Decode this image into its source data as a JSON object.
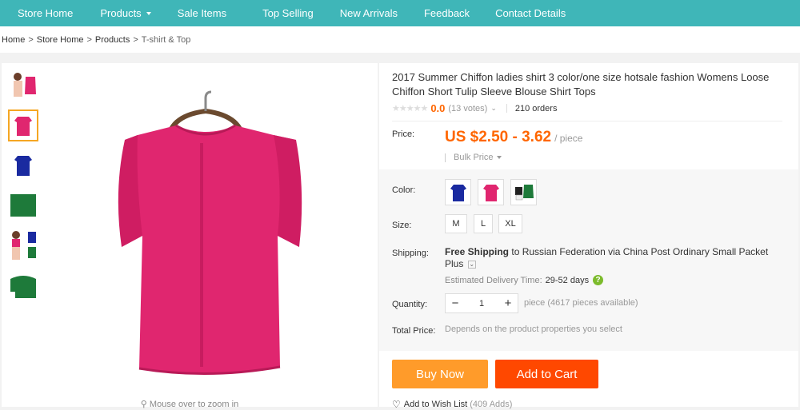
{
  "nav": {
    "items": [
      "Store Home",
      "Products",
      "Sale Items",
      "Top Selling",
      "New Arrivals",
      "Feedback",
      "Contact Details"
    ]
  },
  "breadcrumb": {
    "items": [
      "Home",
      "Store Home",
      "Products",
      "T-shirt & Top"
    ],
    "separator": ">"
  },
  "gallery": {
    "zoom_hint": "Mouse over to zoom in"
  },
  "product": {
    "title": "2017 Summer Chiffon ladies shirt 3 color/one size hotsale fashion Womens Loose Chiffon Short Tulip Sleeve Blouse Shirt Tops",
    "rating": {
      "score": "0.0",
      "votes": "(13 votes)",
      "orders": "210 orders"
    },
    "price": {
      "label": "Price:",
      "value": "US $2.50 - 3.62",
      "unit": "/ piece",
      "bulk_label": "Bulk Price"
    },
    "color": {
      "label": "Color:",
      "options": [
        "blue",
        "rose",
        "green"
      ]
    },
    "size": {
      "label": "Size:",
      "options": [
        "M",
        "L",
        "XL"
      ]
    },
    "shipping": {
      "label": "Shipping:",
      "free": "Free Shipping",
      "to": "to",
      "destination": "Russian Federation via China Post Ordinary Small Packet Plus",
      "delivery_label": "Estimated Delivery Time:",
      "delivery_days": "29-52 days",
      "help": "?"
    },
    "quantity": {
      "label": "Quantity:",
      "value": "1",
      "minus": "−",
      "plus": "+",
      "available": "piece (4617 pieces available)"
    },
    "total": {
      "label": "Total Price:",
      "value": "Depends on the product properties you select"
    },
    "actions": {
      "buy_now": "Buy Now",
      "add_to_cart": "Add to Cart",
      "wishlist": "Add to Wish List",
      "wishlist_count": "(409 Adds)"
    }
  },
  "colors": {
    "nav_bg": "#3fb6b8",
    "price": "#ff6600",
    "buy_now": "#ff9b2a",
    "add_to_cart": "#ff4800",
    "shirt_rose": "#e0266f",
    "shirt_blue": "#1a2aa0",
    "shirt_green": "#1e7a3a"
  }
}
